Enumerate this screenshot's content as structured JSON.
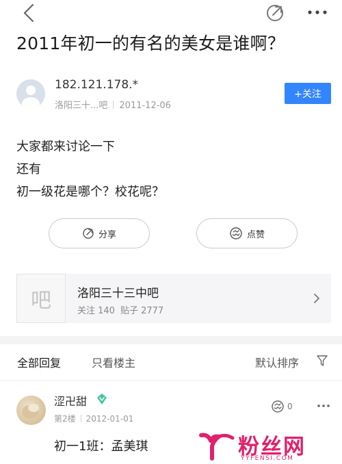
{
  "post": {
    "title": "2011年初一的有名的美女是谁啊？",
    "author": "182.121.178.*",
    "forum_short": "洛阳三十...吧",
    "date": "2011-12-06",
    "follow_label": "+关注",
    "body_lines": [
      "大家都来讨论一下",
      "还有",
      "初一级花是哪个？校花呢？"
    ]
  },
  "actions": {
    "share_label": "分享",
    "like_label": "点赞"
  },
  "forum": {
    "logo_char": "吧",
    "name": "洛阳三十三中吧",
    "followers": "关注 140",
    "posts": "贴子 2777"
  },
  "tabs": {
    "all": "全部回复",
    "op_only": "只看楼主",
    "sort": "默认排序"
  },
  "reply": {
    "name": "涩卍甜",
    "floor": "第2楼",
    "date": "2012-01-01",
    "likes": "0",
    "content": "初一1班：孟美琪"
  },
  "watermark": {
    "name": "粉丝网",
    "domain": "YYFENSI.COM"
  },
  "colors": {
    "accent": "#3385ff",
    "watermark": "#e0216d",
    "vip": "#3cc7a0"
  }
}
